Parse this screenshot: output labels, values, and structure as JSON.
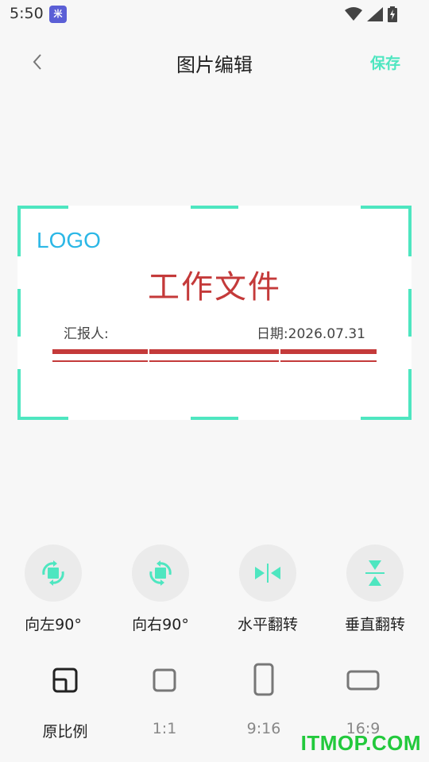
{
  "status_bar": {
    "time": "5:50",
    "app_badge": "米",
    "icons": [
      "wifi-icon",
      "signal-icon",
      "battery-charging-icon"
    ]
  },
  "header": {
    "back_icon": "chevron-left-icon",
    "title": "图片编辑",
    "save_label": "保存",
    "accent_color": "#4ee6c0"
  },
  "document": {
    "logo_text": "LOGO",
    "title": "工作文件",
    "reporter_label": "汇报人:",
    "date_label": "日期:2026.07.31",
    "title_color": "#c43a3a",
    "logo_color": "#2bb7e6"
  },
  "tools": [
    {
      "label": "向左90°",
      "icon": "rotate-left-icon"
    },
    {
      "label": "向右90°",
      "icon": "rotate-right-icon"
    },
    {
      "label": "水平翻转",
      "icon": "flip-horizontal-icon"
    },
    {
      "label": "垂直翻转",
      "icon": "flip-vertical-icon"
    }
  ],
  "ratios": [
    {
      "label": "原比例",
      "icon": "original-ratio-icon",
      "selected": true
    },
    {
      "label": "1:1",
      "icon": "square-ratio-icon",
      "selected": false
    },
    {
      "label": "9:16",
      "icon": "portrait-ratio-icon",
      "selected": false
    },
    {
      "label": "16:9",
      "icon": "landscape-ratio-icon",
      "selected": false
    }
  ],
  "watermark": "ITMOP.COM"
}
